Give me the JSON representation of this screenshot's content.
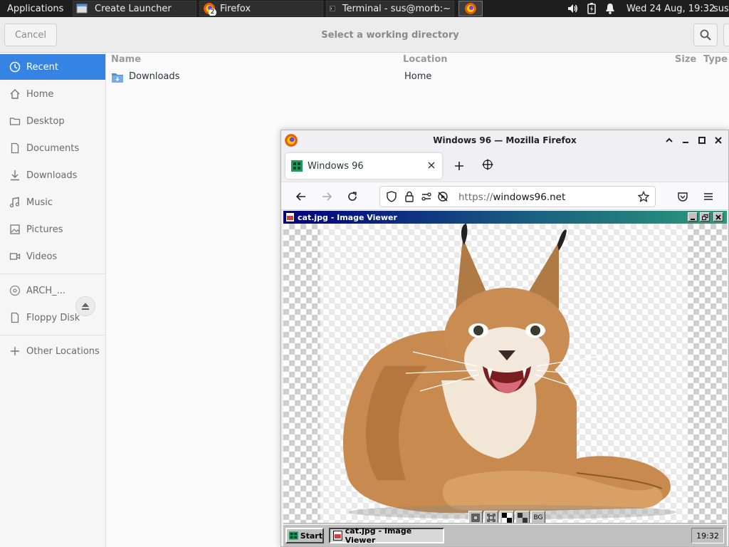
{
  "panel": {
    "applications_label": "Applications",
    "windows": [
      {
        "label": "Create Launcher"
      },
      {
        "label": "Firefox",
        "badge": "2"
      },
      {
        "label": "Terminal - sus@morb:~"
      }
    ],
    "clock": "Wed 24 Aug, 19:32",
    "user": "sus"
  },
  "chooser": {
    "cancel_label": "Cancel",
    "title": "Select a working directory",
    "sidebar": [
      {
        "label": "Recent",
        "icon": "clock-icon"
      },
      {
        "label": "Home",
        "icon": "home-icon"
      },
      {
        "label": "Desktop",
        "icon": "folder-icon"
      },
      {
        "label": "Documents",
        "icon": "document-icon"
      },
      {
        "label": "Downloads",
        "icon": "download-icon"
      },
      {
        "label": "Music",
        "icon": "music-icon"
      },
      {
        "label": "Pictures",
        "icon": "picture-icon"
      },
      {
        "label": "Videos",
        "icon": "video-icon"
      },
      {
        "label": "ARCH_...",
        "icon": "disc-icon"
      },
      {
        "label": "Floppy Disk",
        "icon": "floppy-icon"
      },
      {
        "label": "Other Locations",
        "icon": "plus-icon"
      }
    ],
    "columns": {
      "name": "Name",
      "location": "Location",
      "size": "Size",
      "type": "Type"
    },
    "files": [
      {
        "name": "Downloads",
        "location": "Home"
      }
    ]
  },
  "firefox": {
    "title": "Windows 96 — Mozilla Firefox",
    "tab_label": "Windows 96",
    "url_scheme": "https://",
    "url_host": "windows96.net"
  },
  "win96": {
    "viewer_title": "cat.jpg - Image Viewer",
    "tool_bg_label": "BG",
    "start_label": "Start",
    "task_item_label": "cat.jpg - Image Viewer",
    "clock": "19:32"
  },
  "colors": {
    "accent": "#3584e4",
    "panel": "#1e1e1e",
    "win96_title": "#000080"
  }
}
